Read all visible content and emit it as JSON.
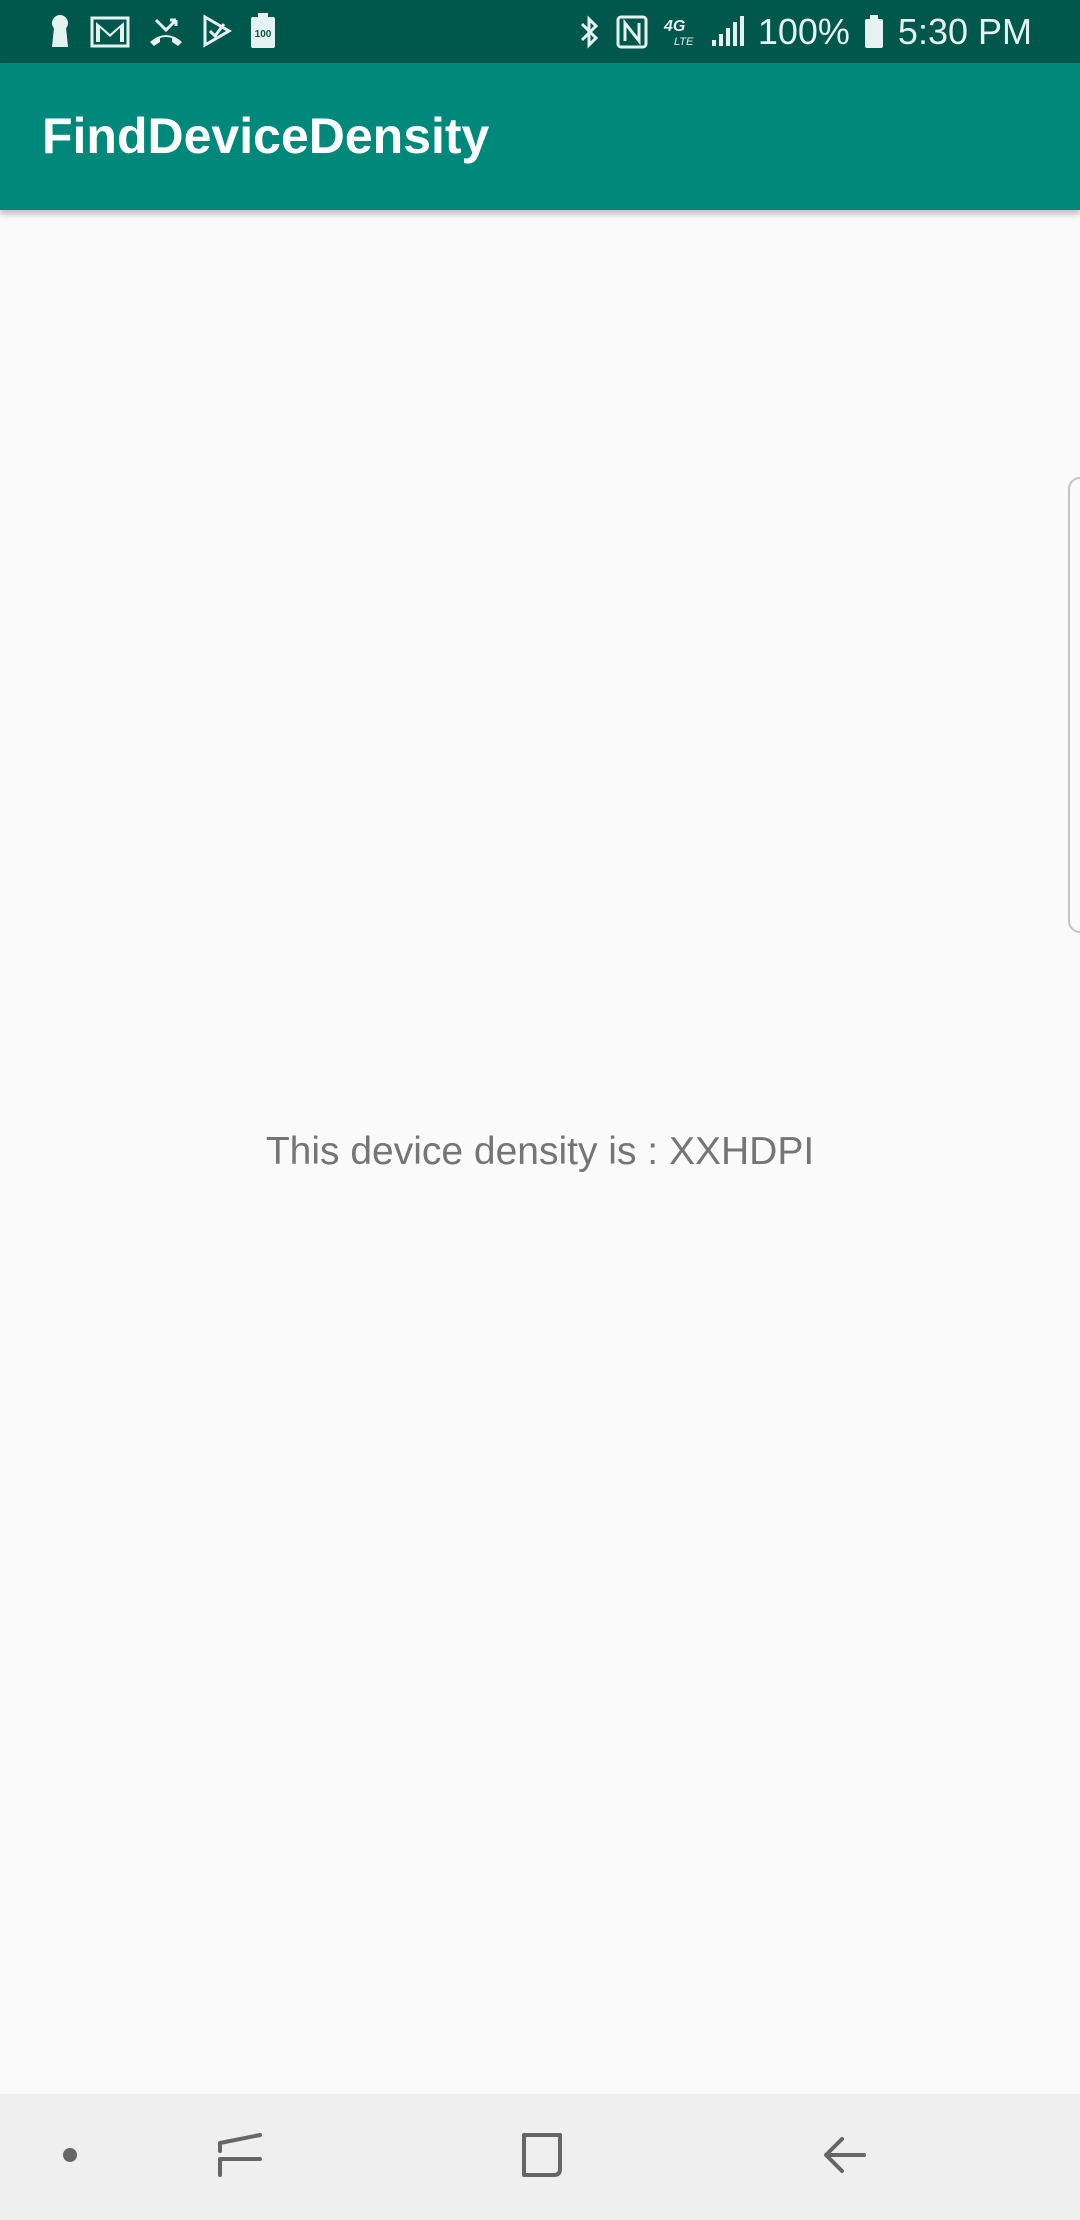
{
  "status_bar": {
    "battery_percent": "100%",
    "time": "5:30 PM",
    "left_icons": [
      "keyhole-icon",
      "gmail-icon",
      "missed-call-icon",
      "play-store-icon",
      "battery-100-icon"
    ],
    "right_icons": [
      "bluetooth-icon",
      "nfc-icon",
      "4g-lte-icon",
      "signal-icon",
      "battery-icon"
    ],
    "background_color": "#00574b"
  },
  "app_bar": {
    "title": "FindDeviceDensity",
    "background_color": "#00897b"
  },
  "main": {
    "density_text": "This device density is : XXHDPI"
  },
  "nav_bar": {
    "buttons": [
      "dot-icon",
      "recents-icon",
      "home-icon",
      "back-icon"
    ]
  }
}
